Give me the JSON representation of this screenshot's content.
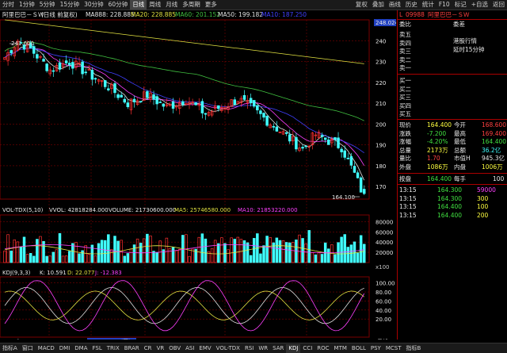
{
  "toolbar": {
    "items": [
      "分时",
      "1分钟",
      "5分钟",
      "15分钟",
      "30分钟",
      "60分钟",
      "日线",
      "周线",
      "月线",
      "多周期",
      "更多"
    ],
    "right_items": [
      "复权",
      "叠加",
      "画线",
      "历史",
      "统计",
      "F10",
      "标记",
      "+自选",
      "返回"
    ]
  },
  "chart_header": {
    "title": "阿里巴巴－ＳＷ",
    "mode": "(日线 前复权)",
    "ma888": "MA888: 228.885",
    "ma20": "MA20: 228.885",
    "ma60": "MA60: 201.152",
    "ma50": "MA50: 199.182",
    "ma_last": "MA10: 187.250"
  },
  "colors": {
    "up": "#ff3030",
    "down": "#40ffff",
    "ma_white": "#e0e0e0",
    "ma_yellow": "#e0e040",
    "ma_green": "#40c040",
    "ma_blue": "#4040ff",
    "ma_magenta": "#ff40ff",
    "grid": "#7a0000"
  },
  "price_axis": {
    "labels": [
      "248.024",
      "240",
      "230",
      "220",
      "210",
      "200",
      "190",
      "180",
      "170"
    ]
  },
  "annotations": {
    "high": "241.600",
    "low": "164.100"
  },
  "volume_header": {
    "name": "VOL-TDX(5,10)",
    "vvol": "VVOL: 42818284.000",
    "volume": "VOLUME: 21730600.000",
    "ma5": "MA5: 25746580.000",
    "ma10": "MA10: 21853220.000"
  },
  "volume_axis": {
    "labels": [
      "80000",
      "60000",
      "40000",
      "20000"
    ],
    "unit": "x100"
  },
  "kdj_header": {
    "name": "KDJ(9,3,3)",
    "k": "K: 10.591",
    "d": "D: 22.077",
    "j": "J: -12.383"
  },
  "kdj_axis": {
    "labels": [
      "100.00",
      "80.00",
      "60.00",
      "40.00",
      "20.00"
    ]
  },
  "date_axis": {
    "labels": [
      "2021年",
      "5",
      "2021/05/06(四)",
      "6",
      "7",
      "8",
      "9",
      "日线"
    ]
  },
  "bottom_tabs": [
    "指标A",
    "窗口",
    "MACD",
    "DMI",
    "DMA",
    "FSL",
    "TRIX",
    "BRAR",
    "CR",
    "VR",
    "OBV",
    "ASI",
    "EMV",
    "VOL-TDX",
    "RSI",
    "WR",
    "SAR",
    "KDJ",
    "CCI",
    "ROC",
    "MTM",
    "BOLL",
    "PSY",
    "MCST",
    "指标B"
  ],
  "panel": {
    "code": "09988",
    "name": "阿里巴巴－ＳＷ",
    "title_label": "L",
    "committee_labels": [
      "委比",
      "委差"
    ],
    "sell_labels": [
      "卖五",
      "卖四",
      "卖三",
      "卖二",
      "卖一"
    ],
    "notice": "港股行情",
    "notice2": "延时15分钟",
    "buy_labels": [
      "买一",
      "买二",
      "买三",
      "买四",
      "买五"
    ],
    "quotes": [
      {
        "l1": "现价",
        "v1": "164.400",
        "l2": "今开",
        "v2": "168.600"
      },
      {
        "l1": "涨跌",
        "v1": "-7.200",
        "l2": "最高",
        "v2": "169.400"
      },
      {
        "l1": "涨幅",
        "v1": "-4.20%",
        "l2": "最低",
        "v2": "164.400"
      },
      {
        "l1": "总量",
        "v1": "2173万",
        "l2": "总额",
        "v2": "36.2亿"
      },
      {
        "l1": "量比",
        "v1": "1.70",
        "l2": "市值H",
        "v2": "945.3亿"
      },
      {
        "l1": "外盘",
        "v1": "1086万",
        "l2": "内盘",
        "v2": "1006万"
      }
    ],
    "bid": {
      "l1": "按盘",
      "v1": "164.400",
      "l2": "每手",
      "v2": "100"
    },
    "ticks": [
      {
        "t": "13:15",
        "p": "164.300",
        "v": "59000"
      },
      {
        "t": "13:15",
        "p": "164.300",
        "v": "300"
      },
      {
        "t": "13:15",
        "p": "164.400",
        "v": "100"
      },
      {
        "t": "13:15",
        "p": "164.400",
        "v": "200"
      }
    ]
  }
}
